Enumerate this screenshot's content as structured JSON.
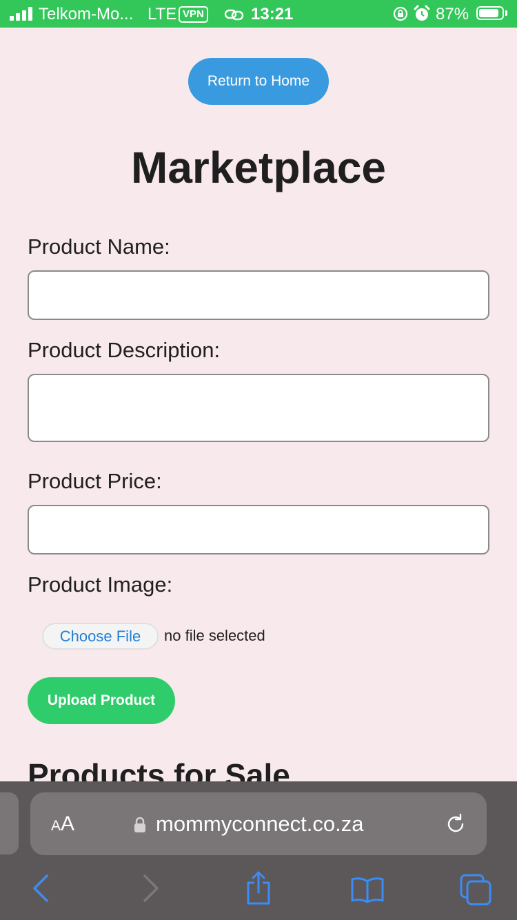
{
  "status_bar": {
    "carrier": "Telkom-Mo...",
    "network": "LTE",
    "vpn_label": "VPN",
    "time": "13:21",
    "battery_percent": "87%",
    "battery_level": 0.87,
    "icons": [
      "signal-icon",
      "link-icon",
      "rotation-lock-icon",
      "alarm-icon",
      "battery-icon"
    ]
  },
  "page": {
    "home_button": "Return to Home",
    "title": "Marketplace",
    "form": {
      "name_label": "Product Name:",
      "name_value": "",
      "description_label": "Product Description:",
      "description_value": "",
      "price_label": "Product Price:",
      "price_value": "",
      "image_label": "Product Image:",
      "choose_file_label": "Choose File",
      "file_status": "no file selected",
      "upload_button": "Upload Product"
    },
    "products_heading": "Products for Sale"
  },
  "browser": {
    "reader_small": "A",
    "reader_large": "A",
    "url": "mommyconnect.co.za",
    "toolbar": [
      "back-icon",
      "forward-icon",
      "share-icon",
      "bookmarks-icon",
      "tabs-icon"
    ]
  },
  "colors": {
    "status_bar_bg": "#33c75a",
    "page_bg": "#f8e9ec",
    "home_button_bg": "#3a9ae0",
    "upload_button_bg": "#2ecc6a",
    "browser_bg": "#5c5859",
    "browser_accent": "#3b8cf7"
  }
}
